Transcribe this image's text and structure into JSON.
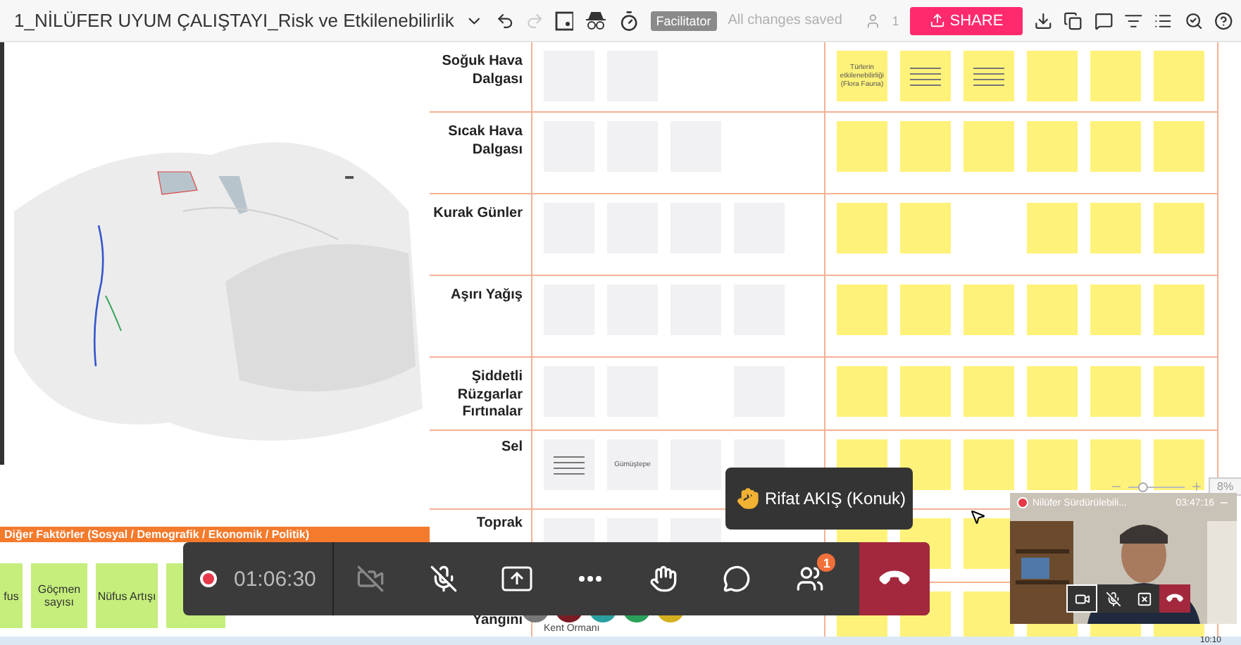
{
  "topbar": {
    "title": "1_NİLÜFER UYUM ÇALIŞTAYI_Risk ve Etkilenebilirlik",
    "redo_disabled": true,
    "badge": "Facilitator",
    "save_status": "All changes saved",
    "user_count": "1",
    "share": "SHARE"
  },
  "board": {
    "rows": [
      {
        "label": "Soğuk Hava Dalgası",
        "grey": [
          {
            "kind": "note"
          },
          {
            "kind": "note"
          }
        ],
        "yellow": [
          {
            "kind": "note",
            "text": "Türlerin etkilenebilirliği (Flora Fauna)"
          },
          {
            "kind": "lines"
          },
          {
            "kind": "lines"
          },
          {
            "kind": "note"
          },
          {
            "kind": "note"
          },
          {
            "kind": "note"
          }
        ]
      },
      {
        "label": "Sıcak Hava Dalgası",
        "grey": [
          {
            "kind": "note"
          },
          {
            "kind": "note"
          },
          {
            "kind": "note"
          }
        ],
        "yellow": [
          {
            "kind": "note"
          },
          {
            "kind": "note"
          },
          {
            "kind": "note"
          },
          {
            "kind": "note"
          },
          {
            "kind": "note"
          },
          {
            "kind": "note"
          }
        ]
      },
      {
        "label": "Kurak Günler",
        "grey": [
          {
            "kind": "note"
          },
          {
            "kind": "note"
          },
          {
            "kind": "note"
          },
          {
            "kind": "note"
          }
        ],
        "yellow": [
          {
            "kind": "note"
          },
          {
            "kind": "note"
          },
          {
            "kind": "gap"
          },
          {
            "kind": "note"
          },
          {
            "kind": "note"
          },
          {
            "kind": "note"
          }
        ]
      },
      {
        "label": "Aşırı Yağış",
        "grey": [
          {
            "kind": "note"
          },
          {
            "kind": "note"
          },
          {
            "kind": "note"
          },
          {
            "kind": "note"
          }
        ],
        "yellow": [
          {
            "kind": "note"
          },
          {
            "kind": "note"
          },
          {
            "kind": "note"
          },
          {
            "kind": "note"
          },
          {
            "kind": "note"
          },
          {
            "kind": "note"
          }
        ]
      },
      {
        "label": "Şiddetli Rüzgarlar Fırtınalar",
        "grey": [
          {
            "kind": "note"
          },
          {
            "kind": "note"
          },
          {
            "kind": "gap"
          },
          {
            "kind": "note"
          }
        ],
        "yellow": [
          {
            "kind": "note"
          },
          {
            "kind": "note"
          },
          {
            "kind": "note"
          },
          {
            "kind": "note"
          },
          {
            "kind": "note"
          },
          {
            "kind": "note"
          }
        ]
      },
      {
        "label": "Sel",
        "grey": [
          {
            "kind": "lines"
          },
          {
            "kind": "note",
            "text": "Gümüştepe"
          },
          {
            "kind": "note"
          },
          {
            "kind": "note"
          }
        ],
        "yellow": [
          {
            "kind": "note"
          },
          {
            "kind": "note"
          },
          {
            "kind": "note"
          },
          {
            "kind": "note"
          },
          {
            "kind": "note"
          },
          {
            "kind": "note"
          }
        ]
      },
      {
        "label": "Toprak",
        "grey": [
          {
            "kind": "note"
          },
          {
            "kind": "note"
          },
          {
            "kind": "note"
          }
        ],
        "yellow": [
          {
            "kind": "note"
          },
          {
            "kind": "note"
          },
          {
            "kind": "note"
          }
        ]
      },
      {
        "label": "Yangını",
        "grey": [],
        "yellow": [
          {
            "kind": "note"
          },
          {
            "kind": "note"
          },
          {
            "kind": "note"
          },
          {
            "kind": "note"
          },
          {
            "kind": "note"
          },
          {
            "kind": "note"
          }
        ],
        "caption": "Kent Ormanı"
      }
    ]
  },
  "factors": {
    "heading": "Diğer Faktörler (Sosyal / Demografik / Ekonomik / Politik)",
    "cards": [
      {
        "kind": "text",
        "text": "fus"
      },
      {
        "kind": "text",
        "text": "Göçmen sayısı"
      },
      {
        "kind": "text",
        "text": "Nüfus Artışı"
      },
      {
        "kind": "blank"
      }
    ]
  },
  "zoom": {
    "value": "8%",
    "level": 0.2
  },
  "tooltip": {
    "text": "Rifat AKIŞ (Konuk)"
  },
  "call_bar": {
    "recording": true,
    "time": "01:06:30",
    "camera_on": false,
    "mic_on": false,
    "participants_badge": "1"
  },
  "video": {
    "name": "Nilüfer Sürdürülebili...",
    "time": "03:47:16",
    "camera_selected": true,
    "mic_on": false
  },
  "taskbar": {
    "clock": "10:10"
  }
}
